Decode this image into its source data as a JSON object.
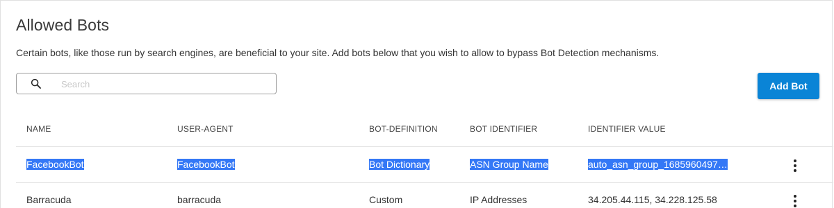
{
  "header": {
    "title": "Allowed Bots",
    "description": "Certain bots, like those run by search engines, are beneficial to your site. Add bots below that you wish to allow to bypass Bot Detection mechanisms."
  },
  "search": {
    "placeholder": "Search",
    "value": "",
    "icon": "search-icon"
  },
  "toolbar": {
    "add_label": "Add Bot"
  },
  "colors": {
    "accent": "#0a84d6",
    "selection": "#3478f6"
  },
  "table": {
    "columns": [
      "NAME",
      "USER-AGENT",
      "BOT-DEFINITION",
      "BOT IDENTIFIER",
      "IDENTIFIER VALUE"
    ],
    "rows": [
      {
        "name": "FacebookBot",
        "user_agent": "FacebookBot",
        "definition": "Bot Dictionary",
        "identifier": "ASN Group Name",
        "value": "auto_asn_group_1685960497…",
        "selected": true
      },
      {
        "name": "Barracuda",
        "user_agent": "barracuda",
        "definition": "Custom",
        "identifier": "IP Addresses",
        "value": "34.205.44.115, 34.228.125.58",
        "selected": false
      }
    ],
    "row_action_icon": "more-vert-icon"
  }
}
